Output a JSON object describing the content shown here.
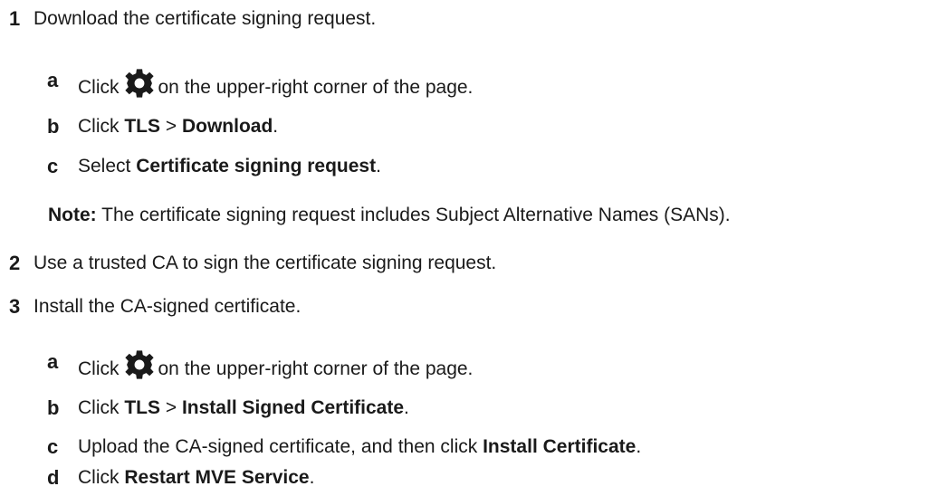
{
  "steps": [
    {
      "number": "1",
      "text": "Download the certificate signing request.",
      "substeps": [
        {
          "letter": "a",
          "pre": "Click",
          "icon": "gear-icon",
          "post": "on the upper-right corner of the page."
        },
        {
          "letter": "b",
          "pre": "Click",
          "bold1": "TLS",
          "sep": ">",
          "bold2": "Download",
          "post": "."
        },
        {
          "letter": "c",
          "pre": "Select",
          "bold1": "Certificate signing request",
          "post": "."
        }
      ],
      "note": {
        "label": "Note:",
        "text": "The certificate signing request includes Subject Alternative Names (SANs)."
      }
    },
    {
      "number": "2",
      "text": "Use a trusted CA to sign the certificate signing request."
    },
    {
      "number": "3",
      "text": "Install the CA-signed certificate.",
      "substeps": [
        {
          "letter": "a",
          "pre": "Click",
          "icon": "gear-icon",
          "post": "on the upper-right corner of the page."
        },
        {
          "letter": "b",
          "pre": "Click",
          "bold1": "TLS",
          "sep": ">",
          "bold2": "Install Signed Certificate",
          "post": "."
        },
        {
          "letter": "c",
          "pre": "Upload the CA-signed certificate, and then click",
          "bold1": "Install Certificate",
          "post": "."
        },
        {
          "letter": "d",
          "pre": "Click",
          "bold1": "Restart MVE Service",
          "post": "."
        }
      ]
    }
  ],
  "colors": {
    "text": "#1a1a1a",
    "icon": "#1a1a1a"
  }
}
